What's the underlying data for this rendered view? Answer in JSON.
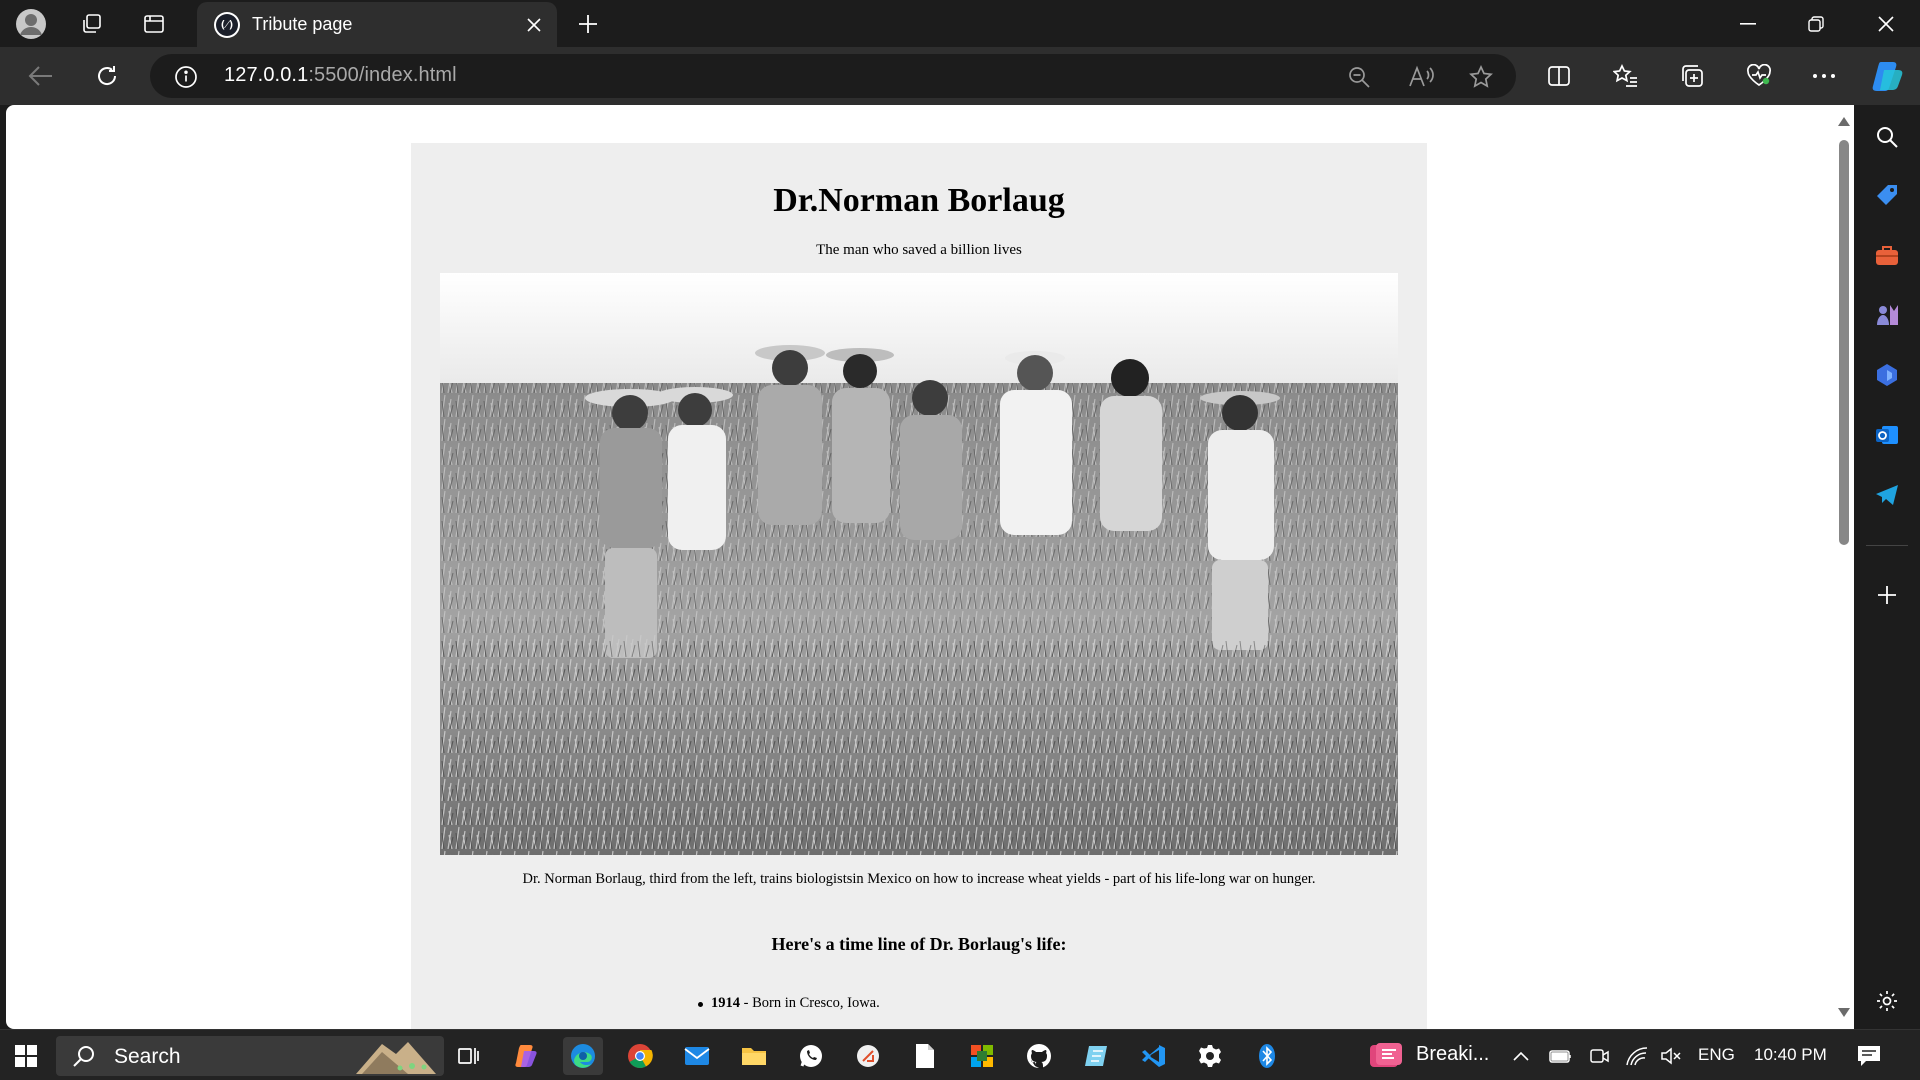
{
  "browser": {
    "tab_title": "Tribute page",
    "favicon_text": "(⁄)",
    "url_host": "127.0.0.1",
    "url_rest": ":5500/index.html"
  },
  "page": {
    "title": "Dr.Norman Borlaug",
    "subtitle": "The man who saved a billion lives",
    "image_caption": "Dr. Norman Borlaug, third from the left, trains biologistsin Mexico on how to increase wheat yields - part of his life-long war on hunger.",
    "timeline_title": "Here's a time line of Dr. Borlaug's life:",
    "timeline": [
      {
        "year": "1914",
        "text": " - Born in Cresco, Iowa."
      }
    ]
  },
  "taskbar": {
    "search_label": "Search",
    "news_label": "Breaki...",
    "language": "ENG",
    "time": "10:40 PM"
  },
  "colors": {
    "page_bg": "#eeeeee",
    "browser_chrome": "#2e2e2e",
    "accent": "#3b8ef0"
  }
}
